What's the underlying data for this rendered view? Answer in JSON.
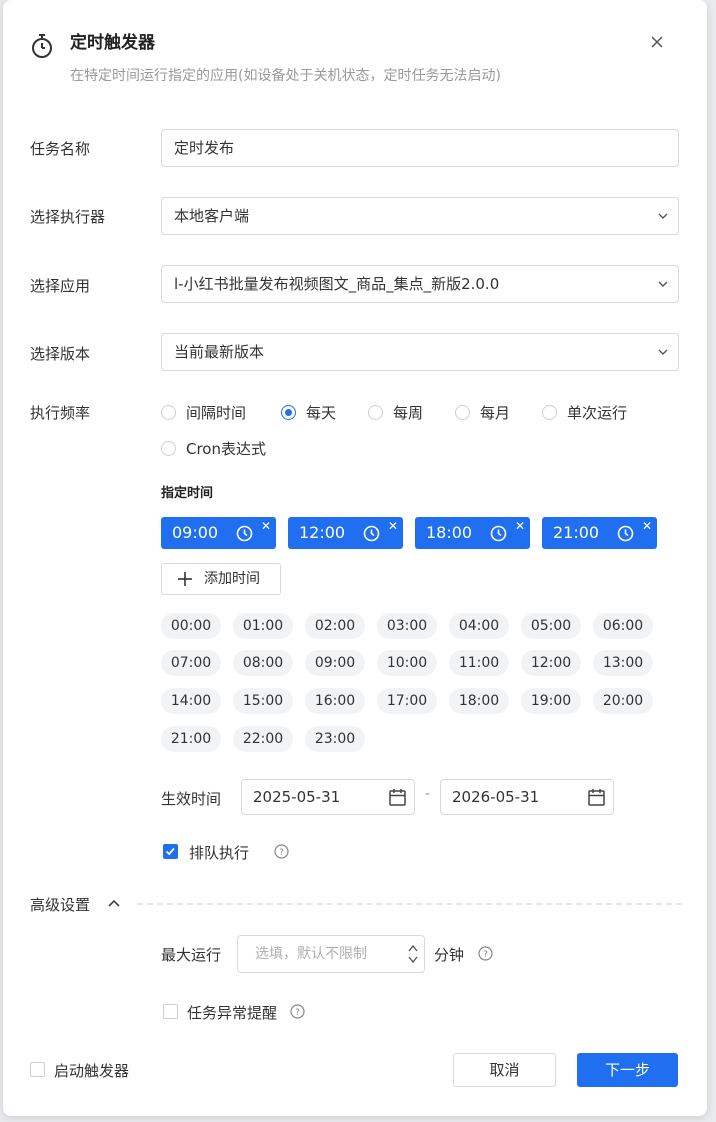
{
  "header": {
    "title": "定时触发器",
    "subtitle": "在特定时间运行指定的应用(如设备处于关机状态，定时任务无法启动)",
    "icon": "stopwatch-icon",
    "close_icon": "close-icon"
  },
  "form": {
    "task_name": {
      "label": "任务名称",
      "value": "定时发布"
    },
    "executor": {
      "label": "选择执行器",
      "value": "本地客户端"
    },
    "app": {
      "label": "选择应用",
      "value": "l-小红书批量发布视频图文_商品_集点_新版2.0.0"
    },
    "version": {
      "label": "选择版本",
      "value": "当前最新版本"
    },
    "frequency": {
      "label": "执行频率",
      "options": [
        "间隔时间",
        "每天",
        "每周",
        "每月",
        "单次运行",
        "Cron表达式"
      ],
      "selected": "每天"
    },
    "schedule": {
      "label": "指定时间",
      "selected_times": [
        "09:00",
        "12:00",
        "18:00",
        "21:00"
      ],
      "add_label": "添加时间",
      "quick_times": [
        "00:00",
        "01:00",
        "02:00",
        "03:00",
        "04:00",
        "05:00",
        "06:00",
        "07:00",
        "08:00",
        "09:00",
        "10:00",
        "11:00",
        "12:00",
        "13:00",
        "14:00",
        "15:00",
        "16:00",
        "17:00",
        "18:00",
        "19:00",
        "20:00",
        "21:00",
        "22:00",
        "23:00"
      ]
    },
    "effective": {
      "label": "生效时间",
      "start": "2025-05-31",
      "separator": "-",
      "end": "2026-05-31"
    },
    "queue": {
      "label": "排队执行",
      "checked": true
    }
  },
  "advanced": {
    "label": "高级设置",
    "expanded": true,
    "max_run": {
      "label": "最大运行",
      "placeholder": "选填，默认不限制",
      "unit": "分钟"
    },
    "alert": {
      "label": "任务异常提醒",
      "checked": false
    }
  },
  "footer": {
    "enable_label": "启动触发器",
    "enable_checked": false,
    "cancel_label": "取消",
    "next_label": "下一步"
  },
  "colors": {
    "primary": "#1f6ff0",
    "tag_bg": "#f2f3f5",
    "border": "#d9d9d9"
  }
}
